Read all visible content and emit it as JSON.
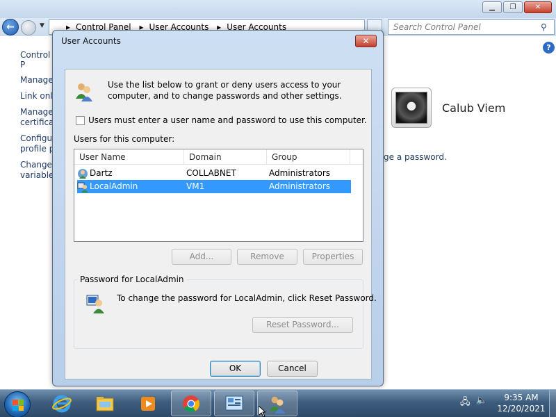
{
  "background": {
    "breadcrumb": [
      "Control Panel",
      "User Accounts",
      "User Accounts"
    ],
    "search_placeholder": "Search Control Panel",
    "left_title": "Control P",
    "left_items": [
      "Manage",
      "Link onli",
      "Manage",
      "certificat",
      "Configur",
      "profile pr",
      "Change",
      "variables"
    ],
    "user_name": "Calub Viem",
    "pw_text": "ge a password.",
    "help_glyph": "?"
  },
  "dialog": {
    "title": "User Accounts",
    "close_glyph": "✕",
    "intro": "Use the list below to grant or deny users access to your computer, and to change passwords and other settings.",
    "must_login_label": "Users must enter a user name and password to use this computer.",
    "must_login_checked": false,
    "users_label": "Users for this computer:",
    "columns": [
      "User Name",
      "Domain",
      "Group"
    ],
    "users": [
      {
        "name": "Dartz",
        "domain": "COLLABNET",
        "group": "Administrators",
        "selected": false
      },
      {
        "name": "LocalAdmin",
        "domain": "VM1",
        "group": "Administrators",
        "selected": true
      }
    ],
    "buttons": {
      "add": "Add...",
      "remove": "Remove",
      "properties": "Properties"
    },
    "password_group": {
      "label": "Password for LocalAdmin",
      "text": "To change the password for LocalAdmin, click Reset Password.",
      "reset": "Reset Password..."
    },
    "ok": "OK",
    "cancel": "Cancel"
  },
  "taskbar": {
    "time": "9:35 AM",
    "date": "12/20/2021",
    "items": [
      "internet-explorer-icon",
      "explorer-icon",
      "media-player-icon",
      "chrome-icon",
      "control-panel-icon",
      "user-accounts-icon"
    ]
  }
}
